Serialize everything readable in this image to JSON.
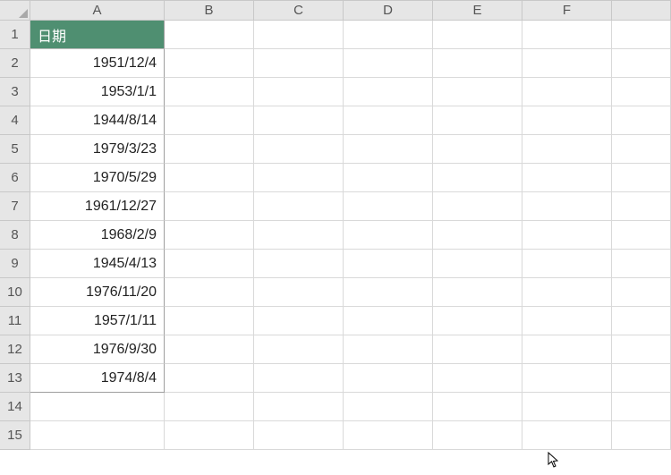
{
  "columns": [
    "A",
    "B",
    "C",
    "D",
    "E",
    "F",
    ""
  ],
  "rowCount": 15,
  "headerCell": {
    "label": "日期"
  },
  "dataCells": [
    "1951/12/4",
    "1953/1/1",
    "1944/8/14",
    "1979/3/23",
    "1970/5/29",
    "1961/12/27",
    "1968/2/9",
    "1945/4/13",
    "1976/11/20",
    "1957/1/11",
    "1976/9/30",
    "1974/8/4"
  ]
}
